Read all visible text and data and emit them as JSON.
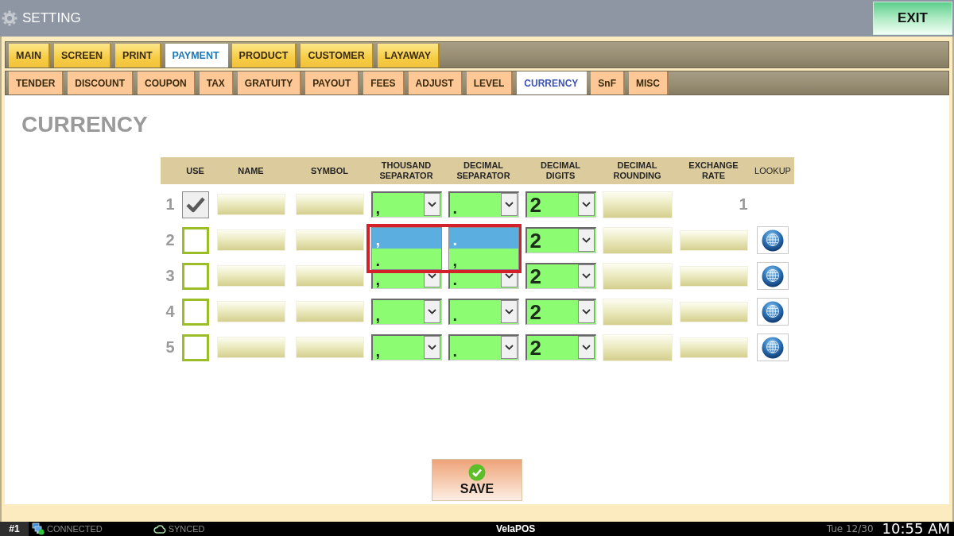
{
  "window": {
    "title": "SETTING",
    "exit_button": "EXIT"
  },
  "main_tabs": [
    {
      "label": "MAIN",
      "selected": false
    },
    {
      "label": "SCREEN",
      "selected": false
    },
    {
      "label": "PRINT",
      "selected": false
    },
    {
      "label": "PAYMENT",
      "selected": true
    },
    {
      "label": "PRODUCT",
      "selected": false
    },
    {
      "label": "CUSTOMER",
      "selected": false
    },
    {
      "label": "LAYAWAY",
      "selected": false
    }
  ],
  "sub_tabs": [
    {
      "label": "TENDER",
      "selected": false
    },
    {
      "label": "DISCOUNT",
      "selected": false
    },
    {
      "label": "COUPON",
      "selected": false
    },
    {
      "label": "TAX",
      "selected": false
    },
    {
      "label": "GRATUITY",
      "selected": false
    },
    {
      "label": "PAYOUT",
      "selected": false
    },
    {
      "label": "FEES",
      "selected": false
    },
    {
      "label": "ADJUST",
      "selected": false
    },
    {
      "label": "LEVEL",
      "selected": false
    },
    {
      "label": "CURRENCY",
      "selected": true
    },
    {
      "label": "SnF",
      "selected": false
    },
    {
      "label": "MISC",
      "selected": false
    }
  ],
  "section_title": "CURRENCY",
  "table": {
    "columns": [
      "USE",
      "NAME",
      "SYMBOL",
      "THOUSAND SEPARATOR",
      "DECIMAL SEPARATOR",
      "DECIMAL DIGITS",
      "DECIMAL ROUNDING",
      "EXCHANGE RATE",
      "LOOKUP"
    ],
    "rows": [
      {
        "number": "1",
        "use": true,
        "highlighted": false,
        "thousand_separator": {
          "value": ",",
          "open": false
        },
        "decimal_separator": {
          "value": ".",
          "open": false
        },
        "decimal_digits": {
          "value": "2",
          "open": false
        },
        "exchange_rate": {
          "kind": "text",
          "value": "1"
        },
        "lookup": false
      },
      {
        "number": "2",
        "use": false,
        "highlighted": true,
        "thousand_separator": {
          "open": true,
          "options": [
            {
              "label": ",",
              "selected": true
            },
            {
              "label": ".",
              "selected": false
            }
          ]
        },
        "decimal_separator": {
          "open": true,
          "options": [
            {
              "label": ".",
              "selected": true
            },
            {
              "label": ",",
              "selected": false
            }
          ]
        },
        "decimal_digits": {
          "value": "2",
          "open": false
        },
        "exchange_rate": {
          "kind": "field"
        },
        "lookup": true
      },
      {
        "number": "3",
        "use": false,
        "highlighted": false,
        "thousand_separator": {
          "value": ",",
          "open": false
        },
        "decimal_separator": {
          "value": ".",
          "open": false
        },
        "decimal_digits": {
          "value": "2",
          "open": false
        },
        "exchange_rate": {
          "kind": "field"
        },
        "lookup": true
      },
      {
        "number": "4",
        "use": false,
        "highlighted": false,
        "thousand_separator": {
          "value": ",",
          "open": false
        },
        "decimal_separator": {
          "value": ".",
          "open": false
        },
        "decimal_digits": {
          "value": "2",
          "open": false
        },
        "exchange_rate": {
          "kind": "field"
        },
        "lookup": true
      },
      {
        "number": "5",
        "use": false,
        "highlighted": false,
        "thousand_separator": {
          "value": ",",
          "open": false
        },
        "decimal_separator": {
          "value": ".",
          "open": false
        },
        "decimal_digits": {
          "value": "2",
          "open": false
        },
        "exchange_rate": {
          "kind": "field"
        },
        "lookup": true
      }
    ]
  },
  "save_button": "SAVE",
  "status_bar": {
    "station": "#1",
    "connection": "CONNECTED",
    "sync": "SYNCED",
    "brand": "VelaPOS",
    "date": "Tue 12/30",
    "time": "10:55 AM"
  }
}
